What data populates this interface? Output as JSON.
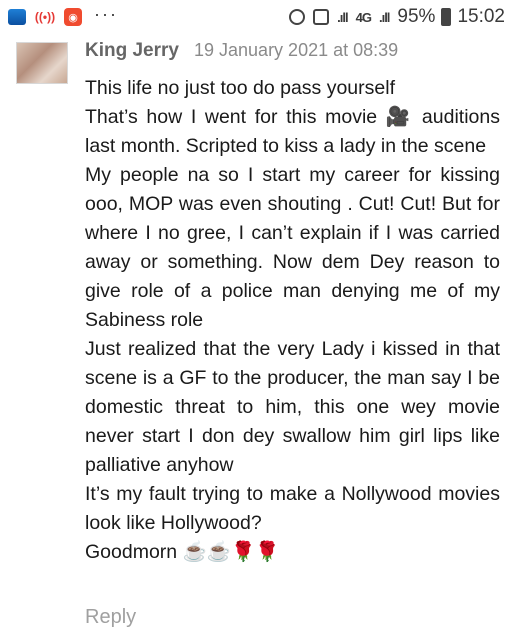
{
  "status_bar": {
    "notification_dots": "···",
    "signal_left": ".ıll",
    "signal_network": "4G",
    "signal_right": ".ıll",
    "battery": "95%",
    "time": "15:02"
  },
  "comment": {
    "author": "King Jerry",
    "timestamp": "19 January 2021 at 08:39",
    "paragraphs": [
      "This life no just too do pass yourself",
      "That’s how I went for this movie 🎥 auditions last month. Scripted to kiss a lady in the scene",
      "My people na so I start my career for kissing ooo, MOP was even shouting . Cut! Cut! But for where I no gree, I can’t explain if I was carried away or something. Now dem Dey reason to give role of a police man denying me of my Sabiness role",
      "Just realized that the very Lady i kissed in that scene is a GF to the producer, the man say I be domestic threat to him, this one wey movie never start I don dey swallow him girl lips like palliative anyhow",
      "It’s my fault trying to make a Nollywood movies look like Hollywood?",
      "Goodmorn ☕☕🌹🌹"
    ],
    "reply_label": "Reply"
  }
}
